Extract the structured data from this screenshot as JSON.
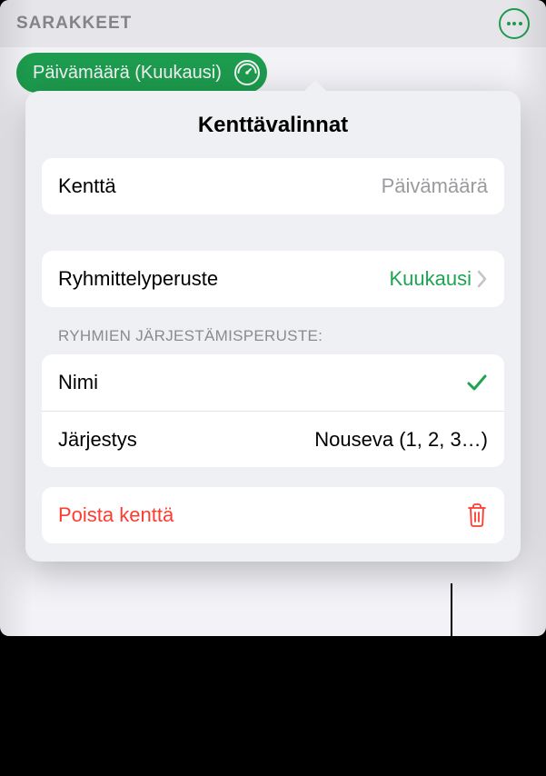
{
  "header": {
    "title": "SARAKKEET"
  },
  "pill": {
    "label": "Päivämäärä (Kuukausi)"
  },
  "popover": {
    "title": "Kenttävalinnat",
    "field_label": "Kenttä",
    "field_value": "Päivämäärä",
    "groupby_label": "Ryhmittelyperuste",
    "groupby_value": "Kuukausi",
    "sort_section": "RYHMIEN JÄRJESTÄMISPERUSTE:",
    "sort_name_label": "Nimi",
    "sort_order_label": "Järjestys",
    "sort_order_value": "Nouseva (1, 2, 3…)",
    "delete_label": "Poista kenttä"
  }
}
